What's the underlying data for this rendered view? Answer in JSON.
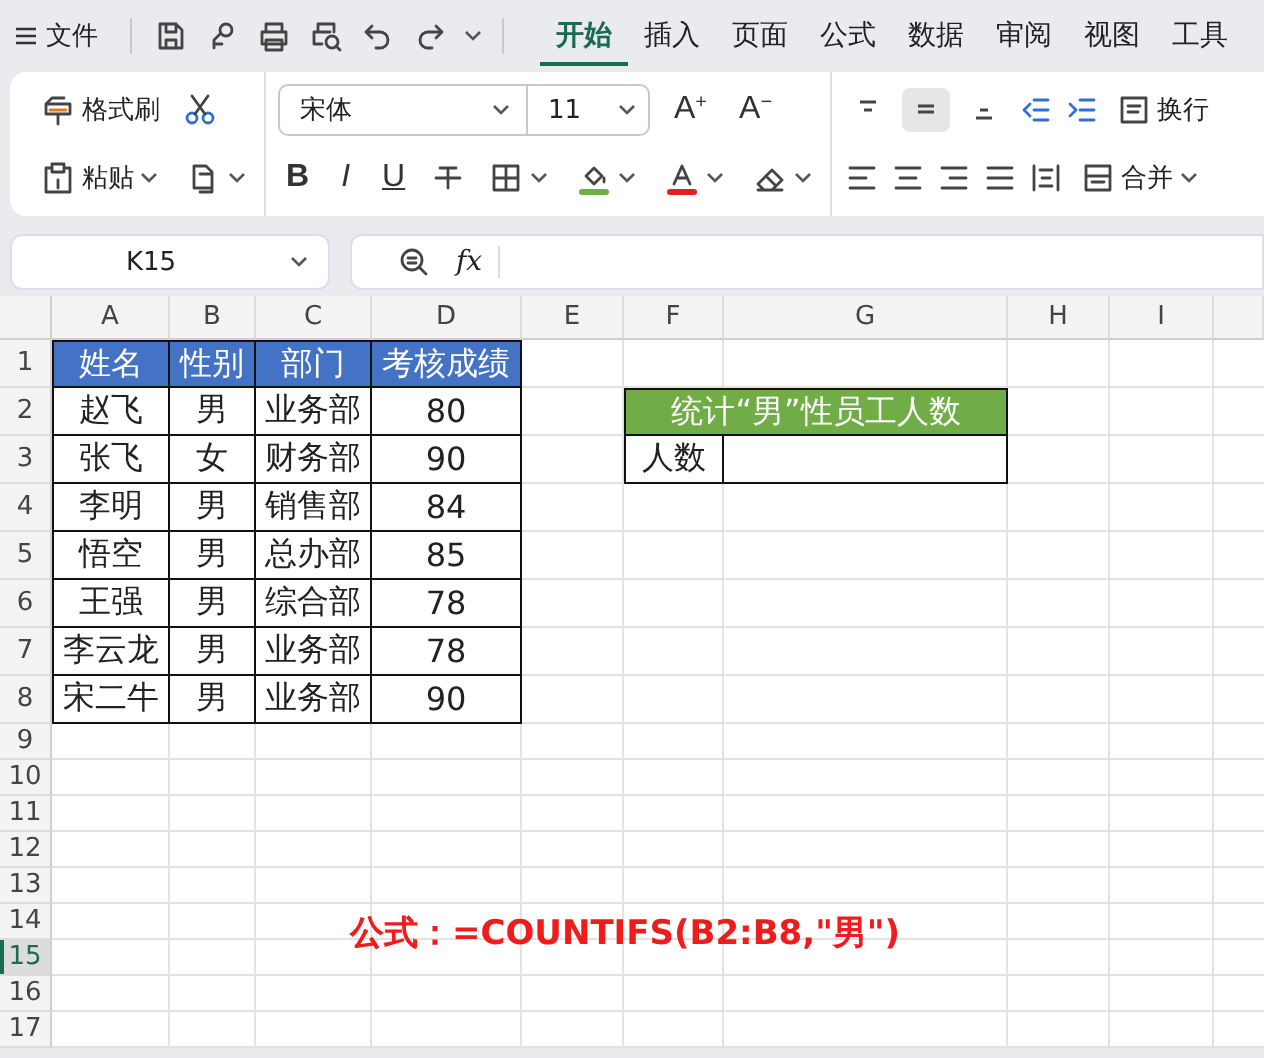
{
  "menu": {
    "label": "文件"
  },
  "tabs": [
    {
      "label": "开始",
      "selected": true
    },
    {
      "label": "插入",
      "selected": false
    },
    {
      "label": "页面",
      "selected": false
    },
    {
      "label": "公式",
      "selected": false
    },
    {
      "label": "数据",
      "selected": false
    },
    {
      "label": "审阅",
      "selected": false
    },
    {
      "label": "视图",
      "selected": false
    },
    {
      "label": "工具",
      "selected": false
    }
  ],
  "ribbon": {
    "format_painter": "格式刷",
    "paste": "粘贴",
    "font_name": "宋体",
    "font_size": "11",
    "font_size_buttons": [
      {
        "label": "A",
        "sign": "+"
      },
      {
        "label": "A",
        "sign": "−"
      }
    ],
    "style_buttons": [
      {
        "kind": "bold",
        "label": "B"
      },
      {
        "kind": "italic",
        "label": "I"
      },
      {
        "kind": "underline",
        "label": "U"
      }
    ],
    "vertical_align": [
      {
        "kind": "top",
        "selected": false
      },
      {
        "kind": "middle",
        "selected": true
      },
      {
        "kind": "bottom",
        "selected": false
      }
    ],
    "wrap": "换行",
    "merge": "合并"
  },
  "name_box": "K15",
  "function_label": "fx",
  "sheet": {
    "columns": [
      "A",
      "B",
      "C",
      "D",
      "E",
      "F",
      "G",
      "H",
      "I"
    ],
    "row_headers": [
      {
        "label": "1",
        "selected": false
      },
      {
        "label": "2",
        "selected": false
      },
      {
        "label": "3",
        "selected": false
      },
      {
        "label": "4",
        "selected": false
      },
      {
        "label": "5",
        "selected": false
      },
      {
        "label": "6",
        "selected": false
      },
      {
        "label": "7",
        "selected": false
      },
      {
        "label": "8",
        "selected": false
      },
      {
        "label": "9",
        "selected": false
      },
      {
        "label": "10",
        "selected": false
      },
      {
        "label": "11",
        "selected": false
      },
      {
        "label": "12",
        "selected": false
      },
      {
        "label": "13",
        "selected": false
      },
      {
        "label": "14",
        "selected": false
      },
      {
        "label": "15",
        "selected": true
      },
      {
        "label": "16",
        "selected": false
      },
      {
        "label": "17",
        "selected": false
      }
    ],
    "table": {
      "columns": [
        "姓名",
        "性别",
        "部门",
        "考核成绩"
      ],
      "rows": [
        [
          "赵飞",
          "男",
          "业务部",
          "80"
        ],
        [
          "张飞",
          "女",
          "财务部",
          "90"
        ],
        [
          "李明",
          "男",
          "销售部",
          "84"
        ],
        [
          "悟空",
          "男",
          "总办部",
          "85"
        ],
        [
          "王强",
          "男",
          "综合部",
          "78"
        ],
        [
          "李云龙",
          "男",
          "业务部",
          "78"
        ],
        [
          "宋二牛",
          "男",
          "业务部",
          "90"
        ]
      ]
    },
    "summary": {
      "title": "统计“男”性员工人数",
      "label": "人数"
    }
  },
  "formula_note": "公式：=COUNTIFS(B2:B8,\"男\")"
}
